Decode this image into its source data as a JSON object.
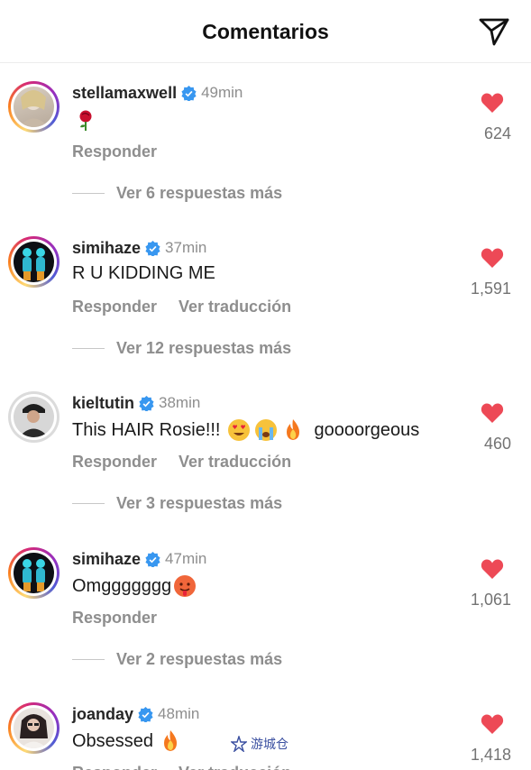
{
  "header": {
    "title": "Comentarios",
    "share_icon": "paper-plane-icon"
  },
  "actions": {
    "reply": "Responder",
    "translate": "Ver traducción"
  },
  "colors": {
    "heart": "#ed4956",
    "verified": "#3897f0",
    "muted": "#8e8e8e"
  },
  "comments": [
    {
      "username": "stellamaxwell",
      "time": "49min",
      "text": "",
      "emoji_after": [
        "rose"
      ],
      "show_translate": false,
      "replies": "Ver 6 respuestas más",
      "likes": "624"
    },
    {
      "username": "simihaze",
      "time": "37min",
      "text": "R U KIDDING ME",
      "show_translate": true,
      "replies": "Ver 12 respuestas más",
      "likes": "1,591"
    },
    {
      "username": "kieltutin",
      "time": "38min",
      "text": "This HAIR Rosie!!!",
      "text_end": "goooorgeous",
      "emoji_after": [
        "heart-eyes",
        "crying",
        "fire"
      ],
      "show_translate": true,
      "replies": "Ver 3 respuestas más",
      "likes": "460"
    },
    {
      "username": "simihaze",
      "time": "47min",
      "text": "Omggggggg",
      "emoji_after": [
        "hot-face"
      ],
      "show_translate": false,
      "replies": "Ver 2 respuestas más",
      "likes": "1,061"
    },
    {
      "username": "joanday",
      "time": "48min",
      "text": "Obsessed",
      "emoji_after": [
        "fire"
      ],
      "show_translate": true,
      "replies": "",
      "likes": "1,418"
    }
  ],
  "watermark": "游城仓"
}
